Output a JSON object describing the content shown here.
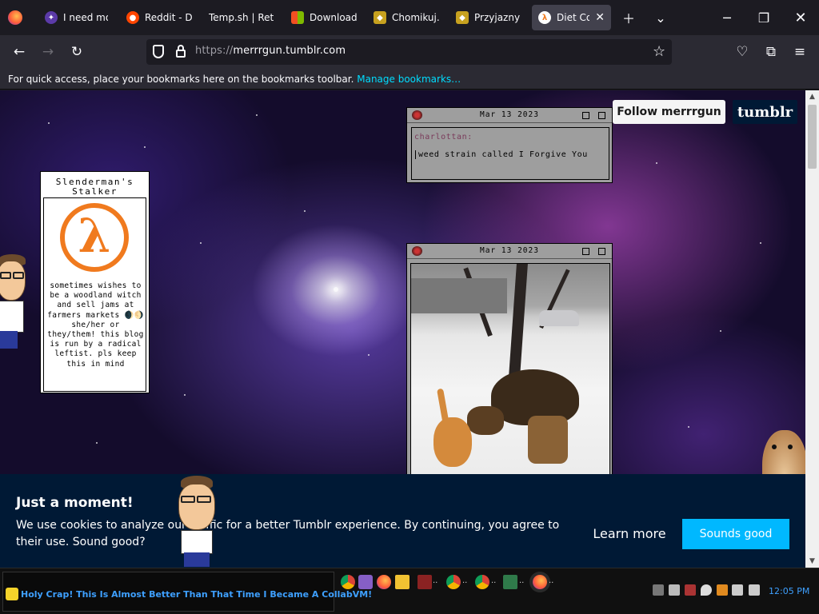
{
  "browser": {
    "tabs": [
      {
        "label": "I need mor",
        "favicon": "gem-icon",
        "active": false
      },
      {
        "label": "Reddit - Di",
        "favicon": "reddit-icon",
        "active": false
      },
      {
        "label": "Temp.sh | Retro",
        "favicon": "",
        "active": false
      },
      {
        "label": "Download",
        "favicon": "windows-icon",
        "active": false
      },
      {
        "label": "Chomikuj.p",
        "favicon": "hamster-icon",
        "active": false
      },
      {
        "label": "Przyjazny d",
        "favicon": "hamster-icon",
        "active": false
      },
      {
        "label": "Diet Cok",
        "favicon": "lambda-icon",
        "active": true
      }
    ],
    "url_scheme": "https://",
    "url_host": "merrrgun.tumblr.com",
    "bookmarks_message": "For quick access, place your bookmarks here on the bookmarks toolbar.",
    "bookmarks_link": "Manage bookmarks…"
  },
  "page": {
    "follow_label": "Follow merrrgun",
    "logo_text": "tumblr",
    "profile": {
      "title": "Slenderman's Stalker",
      "description": "sometimes wishes to be a woodland witch and sell jams at farmers markets 🌒🌖 she/her or they/them! this blog is run by a radical leftist. pls keep this in mind"
    },
    "posts": [
      {
        "date": "Mar 13 2023",
        "username": "charlottan:",
        "text": "weed strain called I Forgive You"
      },
      {
        "date": "Mar 13 2023",
        "media": "video of a dog and cat playing in snow"
      }
    ],
    "cookie": {
      "title": "Just a moment!",
      "text": "We use cookies to analyze our traffic for a better Tumblr experience. By continuing, you agree to their use. Sound good?",
      "learn_more": "Learn more",
      "accept": "Sounds good"
    }
  },
  "taskbar": {
    "winamp_text": "Holy Crap! This Is Almost Better Than That Time I Became A CollabVM!",
    "clock": "12:05 PM",
    "dots": ".."
  },
  "colors": {
    "accent_link": "#00ddff",
    "tumblr_navy": "#001935",
    "accept_button": "#00b8ff",
    "lambda_orange": "#f07a1e"
  }
}
